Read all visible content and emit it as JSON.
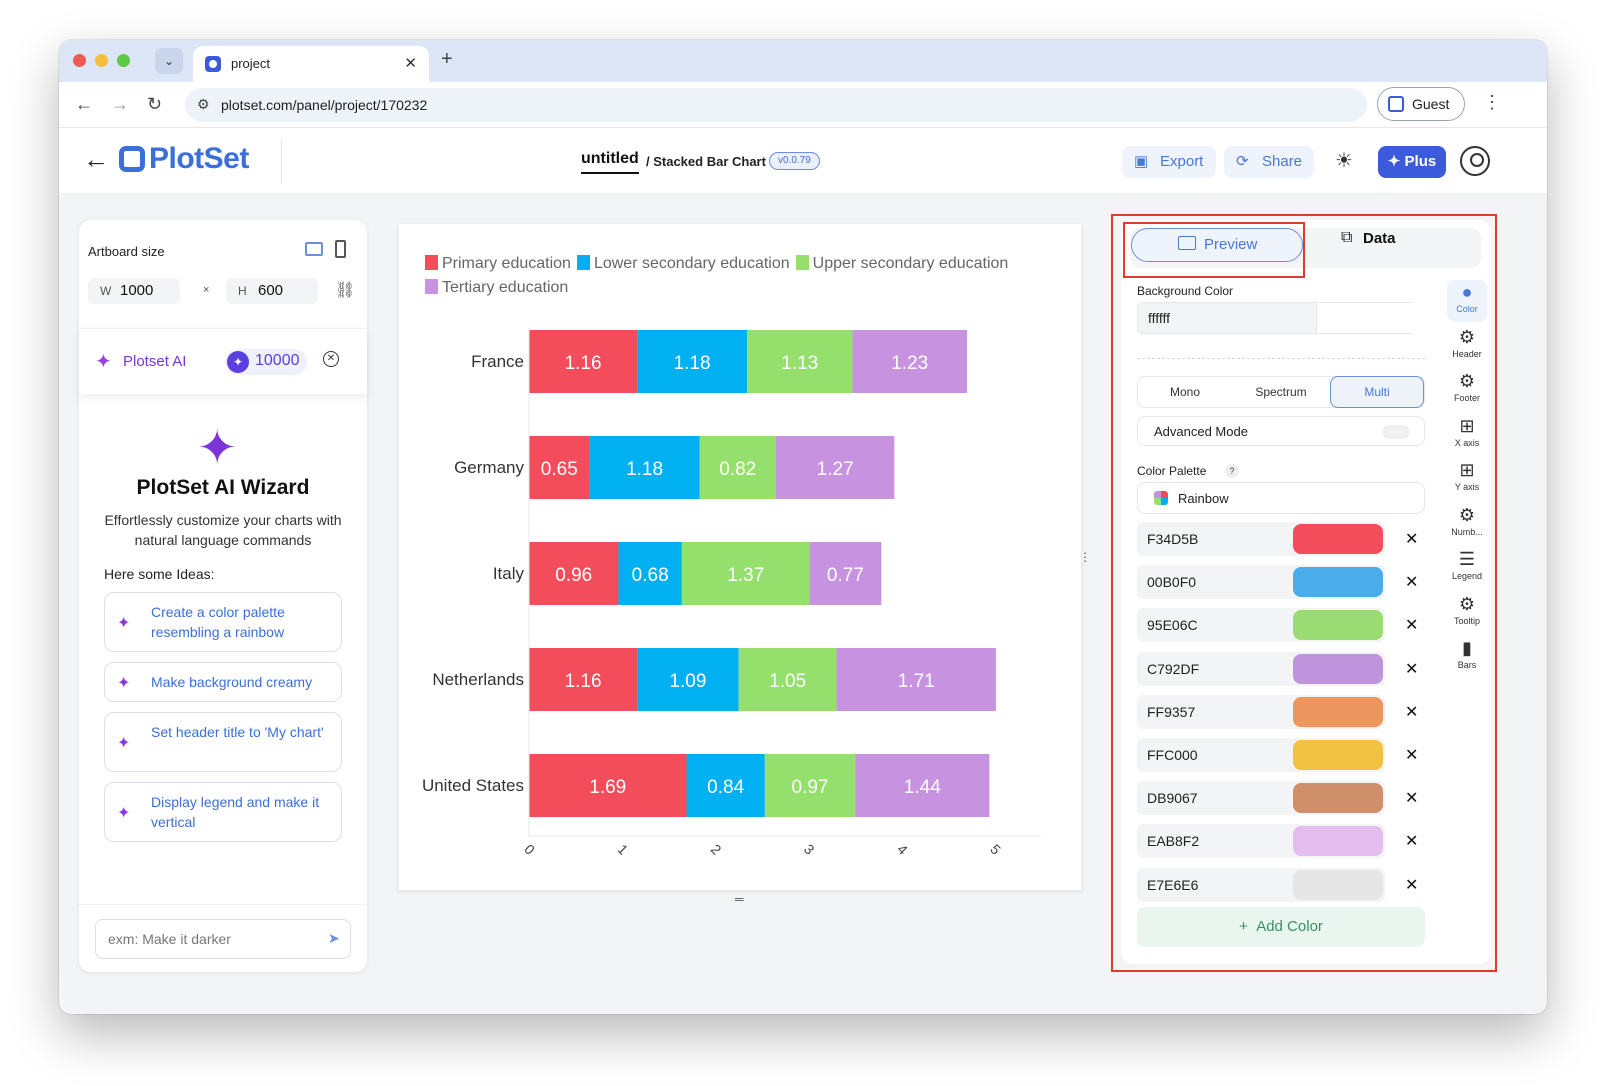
{
  "browser": {
    "tab_title": "project",
    "url": "plotset.com/panel/project/170232",
    "profile_label": "Guest"
  },
  "header": {
    "logo_text": "PlotSet",
    "doc_title": "untitled",
    "doc_subtitle": "/ Stacked Bar Chart",
    "version": "v0.0.79",
    "export_label": "Export",
    "share_label": "Share",
    "plus_label": "Plus"
  },
  "left_panel": {
    "artboard_label": "Artboard size",
    "width_key": "W",
    "width_value": "1000",
    "times": "×",
    "height_key": "H",
    "height_value": "600",
    "ai_label": "Plotset AI",
    "ai_credits": "10000",
    "wizard_title": "PlotSet AI Wizard",
    "wizard_desc": "Effortlessly customize your charts with natural language commands",
    "ideas_label": "Here some Ideas:",
    "ideas": [
      "Create a color palette resembling a rainbow",
      "Make background creamy",
      "Set header title to 'My chart'",
      "Display legend and make it vertical"
    ],
    "chat_placeholder": "exm: Make it darker"
  },
  "chart_data": {
    "type": "bar",
    "orientation": "horizontal",
    "stacked": true,
    "categories": [
      "France",
      "Germany",
      "Italy",
      "Netherlands",
      "United States"
    ],
    "series": [
      {
        "name": "Primary education",
        "color": "#F34D5B",
        "values": [
          1.16,
          0.65,
          0.96,
          1.16,
          1.69
        ]
      },
      {
        "name": "Lower secondary education",
        "color": "#00B0F0",
        "values": [
          1.18,
          1.18,
          0.68,
          1.09,
          0.84
        ]
      },
      {
        "name": "Upper secondary education",
        "color": "#95E06C",
        "values": [
          1.13,
          0.82,
          1.37,
          1.05,
          0.97
        ]
      },
      {
        "name": "Tertiary education",
        "color": "#C792DF",
        "values": [
          1.23,
          1.27,
          0.77,
          1.71,
          1.44
        ]
      }
    ],
    "x_ticks": [
      "0",
      "1",
      "2",
      "3",
      "4",
      "5"
    ],
    "xlim": [
      0,
      5
    ],
    "legend_position": "top",
    "grid": false
  },
  "right_panel": {
    "preview_label": "Preview",
    "data_label": "Data",
    "bg_color_label": "Background Color",
    "bg_color_value": "ffffff",
    "modes": [
      "Mono",
      "Spectrum",
      "Multi"
    ],
    "active_mode": "Multi",
    "advanced_mode_label": "Advanced Mode",
    "palette_label": "Color Palette",
    "palette_help": "?",
    "palette_name": "Rainbow",
    "colors": [
      {
        "hex": "F34D5B",
        "swatch": "#F34D5B"
      },
      {
        "hex": "00B0F0",
        "swatch": "#4AACEB"
      },
      {
        "hex": "95E06C",
        "swatch": "#9BDB73"
      },
      {
        "hex": "C792DF",
        "swatch": "#C094DC"
      },
      {
        "hex": "FF9357",
        "swatch": "#EE965F"
      },
      {
        "hex": "FFC000",
        "swatch": "#F1C141"
      },
      {
        "hex": "DB9067",
        "swatch": "#CF8F6A"
      },
      {
        "hex": "EAB8F2",
        "swatch": "#E3BDEE"
      },
      {
        "hex": "E7E6E6",
        "swatch": "#E7E6E6"
      }
    ],
    "add_color_label": "Add Color",
    "rail": [
      {
        "icon": "color-icon",
        "label": "Color"
      },
      {
        "icon": "gear-icon",
        "label": "Header"
      },
      {
        "icon": "gear-icon",
        "label": "Footer"
      },
      {
        "icon": "grid-icon",
        "label": "X axis"
      },
      {
        "icon": "grid-icon",
        "label": "Y axis"
      },
      {
        "icon": "gear-icon",
        "label": "Numb..."
      },
      {
        "icon": "legend-icon",
        "label": "Legend"
      },
      {
        "icon": "gear-icon",
        "label": "Tooltip"
      },
      {
        "icon": "bars-icon",
        "label": "Bars"
      }
    ]
  }
}
